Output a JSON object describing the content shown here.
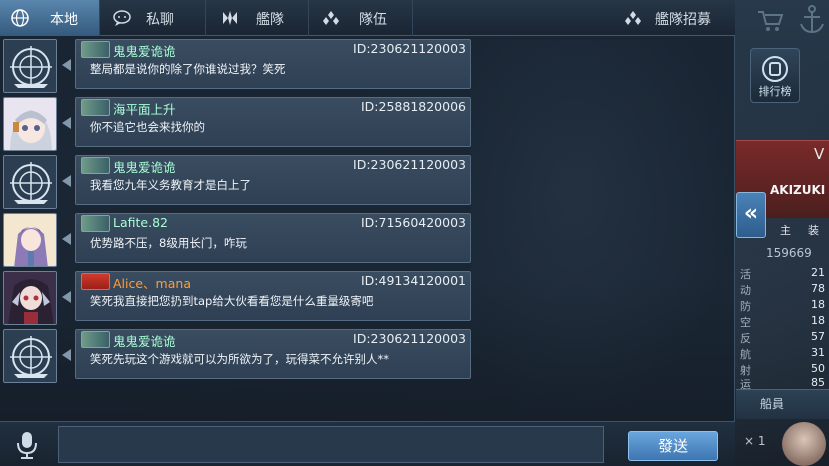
{
  "tabs": {
    "local": "本地",
    "private": "私聊",
    "fleet": "艦隊",
    "team": "隊伍",
    "recruit": "艦隊招募"
  },
  "active_tab": "local",
  "messages": [
    {
      "name": "鬼鬼爱诡诡",
      "id": "ID:230621120003",
      "text": "整局都是说你的除了你谁说过我？笑死",
      "badge": "rank",
      "avatar": "ship-emblem",
      "name_color": "#a8ffd6"
    },
    {
      "name": "海平面上升",
      "id": "ID:25881820006",
      "text": "你不追它也会来找你的",
      "badge": "rank",
      "avatar": "anime-girl-silver",
      "name_color": "#a8ffd6"
    },
    {
      "name": "鬼鬼爱诡诡",
      "id": "ID:230621120003",
      "text": "我看您九年义务教育才是白上了",
      "badge": "rank",
      "avatar": "ship-emblem",
      "name_color": "#a8ffd6"
    },
    {
      "name": "Lafite.82",
      "id": "ID:71560420003",
      "text": "优势路不压，8级用长门，咋玩",
      "badge": "rank",
      "avatar": "anime-girl-purple",
      "name_color": "#a8ffd6"
    },
    {
      "name": "Alice、mana",
      "id": "ID:49134120001",
      "text": "笑死我直接把您扔到tap给大伙看看您是什么重量级寄吧",
      "badge": "flag",
      "avatar": "anime-girl-dark",
      "name_color": "#ff9c3a"
    },
    {
      "name": "鬼鬼爱诡诡",
      "id": "ID:230621120003",
      "text": "笑死先玩这个游戏就可以为所欲为了，玩得菜不允许别人**",
      "badge": "rank",
      "avatar": "ship-emblem",
      "name_color": "#a8ffd6"
    }
  ],
  "input": {
    "placeholder": "",
    "value": ""
  },
  "send_label": "發送",
  "side": {
    "ranking_label": "排行榜",
    "ship_letter": "V",
    "ship_name": "AKIZUKI",
    "tab_a": "主",
    "tab_b": "装",
    "number": "159669",
    "stats": [
      {
        "label": "活",
        "value": "21"
      },
      {
        "label": "动",
        "value": "78"
      },
      {
        "label": "防",
        "value": "18"
      },
      {
        "label": "空",
        "value": "18"
      },
      {
        "label": "反",
        "value": "57"
      },
      {
        "label": "航",
        "value": "31"
      },
      {
        "label": "射",
        "value": "50"
      },
      {
        "label": "运",
        "value": "85"
      }
    ],
    "crew_label": "船員",
    "multiplier": "× 1"
  },
  "colors": {
    "accent": "#5a86ad",
    "send_button": "#4f8cc9",
    "name_default": "#a8ffd6",
    "name_highlight": "#ff9c3a"
  },
  "icons": {
    "local": "globe-icon",
    "private": "chat-bubble-icon",
    "fleet": "fleet-icon",
    "team": "team-icon",
    "recruit": "recruit-icon",
    "voice": "microphone-icon",
    "collapse": "double-chevron-left-icon"
  }
}
